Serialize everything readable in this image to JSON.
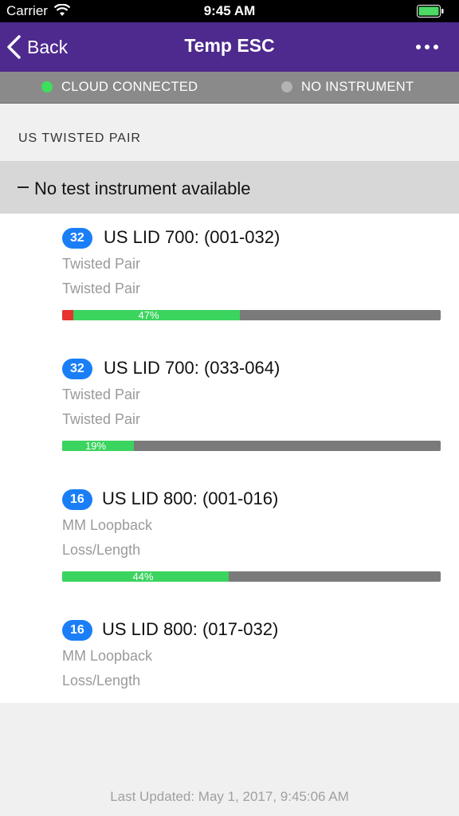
{
  "status_bar": {
    "carrier": "Carrier",
    "time": "9:45 AM"
  },
  "nav": {
    "back_label": "Back",
    "title": "Temp ESC"
  },
  "connection": {
    "cloud_status": "CLOUD CONNECTED",
    "instrument_status": "NO INSTRUMENT"
  },
  "section": {
    "header": "US TWISTED PAIR"
  },
  "group": {
    "label": "No test instrument available"
  },
  "items": [
    {
      "count": "32",
      "title": "US LID 700: (001-032)",
      "line1": "Twisted Pair",
      "line2": "Twisted Pair",
      "progress_pct": "47%",
      "progress_fraction": 0.47,
      "failed_fraction": 0.03
    },
    {
      "count": "32",
      "title": "US LID 700: (033-064)",
      "line1": "Twisted Pair",
      "line2": "Twisted Pair",
      "progress_pct": "19%",
      "progress_fraction": 0.19,
      "failed_fraction": 0
    },
    {
      "count": "16",
      "title": "US LID 800: (001-016)",
      "line1": "MM Loopback",
      "line2": "Loss/Length",
      "progress_pct": "44%",
      "progress_fraction": 0.44,
      "failed_fraction": 0
    },
    {
      "count": "16",
      "title": "US LID 800: (017-032)",
      "line1": "MM Loopback",
      "line2": "Loss/Length"
    }
  ],
  "footer": {
    "last_updated": "Last Updated: May 1, 2017, 9:45:06 AM"
  },
  "colors": {
    "nav_bg": "#4e2a8e",
    "badge": "#1a7ef7",
    "progress_fill": "#3bd45e",
    "progress_fail": "#e8322f",
    "cloud_dot": "#3ce05a"
  }
}
